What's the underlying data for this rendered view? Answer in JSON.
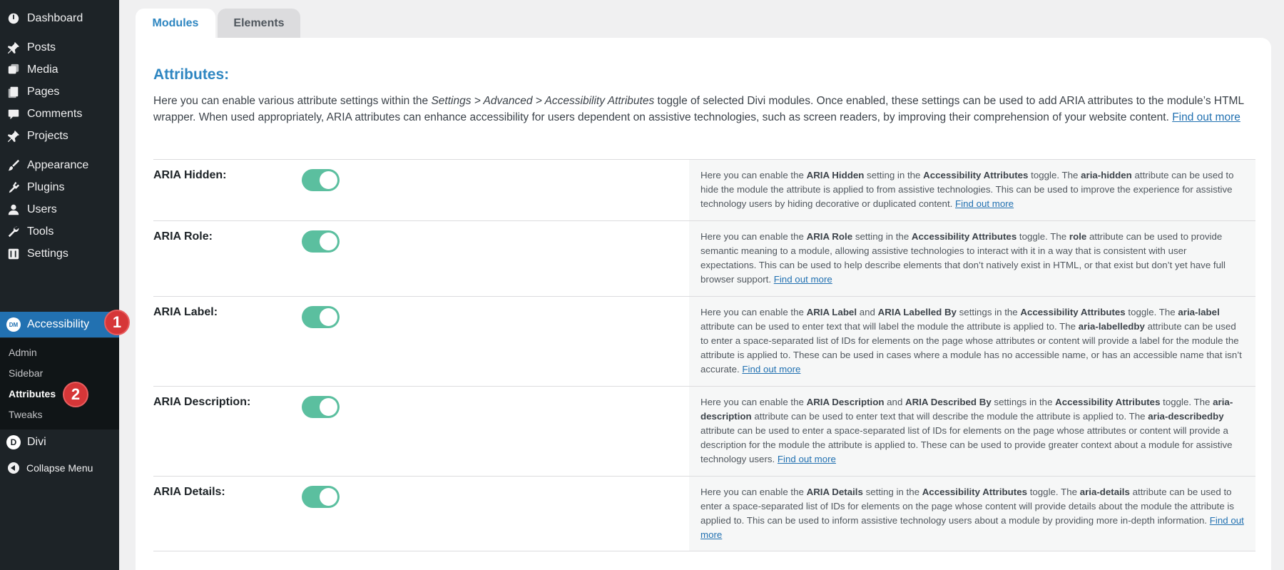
{
  "sidebar": {
    "items": [
      {
        "label": "Dashboard",
        "icon": "dashboard-icon"
      },
      {
        "label": "Posts",
        "icon": "pin-icon"
      },
      {
        "label": "Media",
        "icon": "media-icon"
      },
      {
        "label": "Pages",
        "icon": "pages-icon"
      },
      {
        "label": "Comments",
        "icon": "comment-icon"
      },
      {
        "label": "Projects",
        "icon": "pin-icon"
      },
      {
        "label": "Appearance",
        "icon": "brush-icon"
      },
      {
        "label": "Plugins",
        "icon": "plugin-icon"
      },
      {
        "label": "Users",
        "icon": "user-icon"
      },
      {
        "label": "Tools",
        "icon": "wrench-icon"
      },
      {
        "label": "Settings",
        "icon": "settings-icon"
      }
    ],
    "active_item": {
      "label": "Accessibility",
      "badge": "DM"
    },
    "submenu": [
      "Admin",
      "Sidebar",
      "Attributes",
      "Tweaks"
    ],
    "current_submenu": "Attributes",
    "divi": {
      "label": "Divi",
      "badge": "D"
    },
    "collapse": {
      "label": "Collapse Menu"
    },
    "steps": [
      "1",
      "2"
    ]
  },
  "tabs": [
    {
      "label": "Modules",
      "active": true
    },
    {
      "label": "Elements",
      "active": false
    }
  ],
  "main": {
    "heading": "Attributes:",
    "intro": {
      "part1": "Here you can enable various attribute settings within the ",
      "italic": "Settings > Advanced > Accessibility Attributes",
      "part2": " toggle of selected Divi modules. Once enabled, these settings can be used to add ARIA attributes to the module’s HTML wrapper. When used appropriately, ARIA attributes can enhance accessibility for users dependent on assistive technologies, such as screen readers, by improving their comprehension of your website content.  ",
      "link": "Find out more"
    },
    "rows": [
      {
        "label": "ARIA Hidden:",
        "enabled": true,
        "desc": [
          {
            "t": "Here you can enable the "
          },
          {
            "b": "ARIA Hidden"
          },
          {
            "t": " setting in the "
          },
          {
            "b": "Accessibility Attributes"
          },
          {
            "t": " toggle. The "
          },
          {
            "b": "aria-hidden"
          },
          {
            "t": " attribute can be used to hide the module the attribute is applied to from assistive technologies. This can be used to improve the experience for assistive technology users by hiding decorative or duplicated content. "
          },
          {
            "a": "Find out more"
          }
        ]
      },
      {
        "label": "ARIA Role:",
        "enabled": true,
        "desc": [
          {
            "t": "Here you can enable the "
          },
          {
            "b": "ARIA Role"
          },
          {
            "t": " setting in the "
          },
          {
            "b": "Accessibility Attributes"
          },
          {
            "t": " toggle. The "
          },
          {
            "b": "role"
          },
          {
            "t": " attribute can be used to provide semantic meaning to a module, allowing assistive technologies to interact with it in a way that is consistent with user expectations. This can be used to help describe elements that don’t natively exist in HTML, or that exist but don’t yet have full browser support. "
          },
          {
            "a": "Find out more"
          }
        ]
      },
      {
        "label": "ARIA Label:",
        "enabled": true,
        "desc": [
          {
            "t": "Here you can enable the "
          },
          {
            "b": "ARIA Label"
          },
          {
            "t": " and "
          },
          {
            "b": "ARIA Labelled By"
          },
          {
            "t": " settings in the "
          },
          {
            "b": "Accessibility Attributes"
          },
          {
            "t": " toggle. The "
          },
          {
            "b": "aria-label"
          },
          {
            "t": " attribute can be used to enter text that will label the module the attribute is applied to. The "
          },
          {
            "b": "aria-labelledby"
          },
          {
            "t": " attribute can be used to enter a space-separated list of IDs for elements on the page whose attributes or content will provide a label for the module the attribute is applied to. These can be used in cases where a module has no accessible name, or has an accessible name that isn’t accurate. "
          },
          {
            "a": "Find out more"
          }
        ]
      },
      {
        "label": "ARIA Description:",
        "enabled": true,
        "desc": [
          {
            "t": "Here you can enable the "
          },
          {
            "b": "ARIA Description"
          },
          {
            "t": " and "
          },
          {
            "b": "ARIA Described By"
          },
          {
            "t": " settings in the "
          },
          {
            "b": "Accessibility Attributes"
          },
          {
            "t": " toggle. The "
          },
          {
            "b": "aria-description"
          },
          {
            "t": " attribute can be used to enter text that will describe the module the attribute is applied to. The "
          },
          {
            "b": "aria-describedby"
          },
          {
            "t": " attribute can be used to enter a space-separated list of IDs for elements on the page whose attributes or content will provide a description for the module the attribute is applied to. These can be used to provide greater context about a module for assistive technology users. "
          },
          {
            "a": "Find out more"
          }
        ]
      },
      {
        "label": "ARIA Details:",
        "enabled": true,
        "desc": [
          {
            "t": "Here you can enable the "
          },
          {
            "b": "ARIA Details"
          },
          {
            "t": " setting in the "
          },
          {
            "b": "Accessibility Attributes"
          },
          {
            "t": " toggle. The "
          },
          {
            "b": "aria-details"
          },
          {
            "t": " attribute can be used to enter a space-separated list of IDs for elements on the page whose content will provide details about the module the attribute is applied to. This can be used to inform assistive technology users about a module by providing more in-depth information. "
          },
          {
            "a": "Find out more"
          }
        ]
      }
    ]
  },
  "colors": {
    "sidebar_bg": "#1d2327",
    "active_bg": "#2271b1",
    "accent_blue": "#2e86c1",
    "toggle_on": "#5bbf9f",
    "step_badge": "#d63638"
  }
}
